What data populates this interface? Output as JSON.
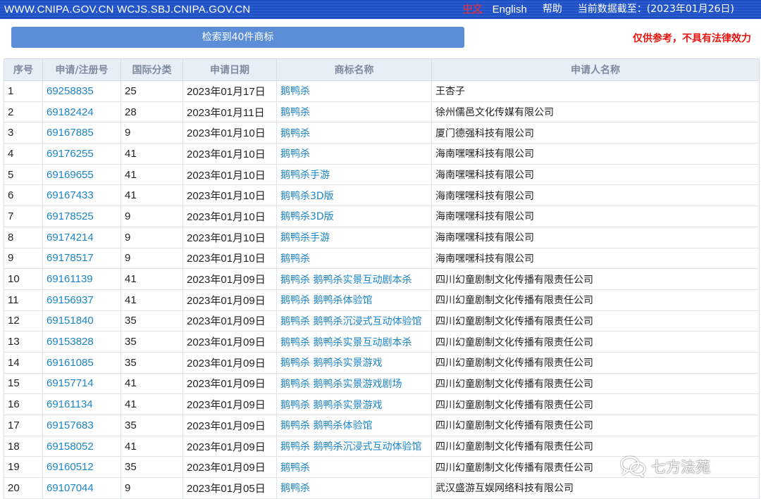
{
  "header": {
    "site": "WWW.CNIPA.GOV.CN WCJS.SBJ.CNIPA.GOV.CN",
    "lang_cn": "中文",
    "lang_en": "English",
    "help": "帮助",
    "data_date": "当前数据截至：(2023年01月26日)"
  },
  "search": {
    "result_label": "检索到40件商标",
    "disclaimer": "仅供参考，不具有法律效力"
  },
  "table": {
    "headers": [
      "序号",
      "申请/注册号",
      "国际分类",
      "申请日期",
      "商标名称",
      "申请人名称"
    ],
    "rows": [
      {
        "no": "1",
        "reg": "69258835",
        "cls": "25",
        "date": "2023年01月17日",
        "mark": "鹅鸭杀",
        "applicant": "王杏子"
      },
      {
        "no": "2",
        "reg": "69182424",
        "cls": "28",
        "date": "2023年01月11日",
        "mark": "鹅鸭杀",
        "applicant": "徐州儒邑文化传媒有限公司"
      },
      {
        "no": "3",
        "reg": "69167885",
        "cls": "9",
        "date": "2023年01月10日",
        "mark": "鹅鸭杀",
        "applicant": "厦门德强科技有限公司"
      },
      {
        "no": "4",
        "reg": "69176255",
        "cls": "41",
        "date": "2023年01月10日",
        "mark": "鹅鸭杀",
        "applicant": "海南嘿嘿科技有限公司"
      },
      {
        "no": "5",
        "reg": "69169655",
        "cls": "41",
        "date": "2023年01月10日",
        "mark": "鹅鸭杀手游",
        "applicant": "海南嘿嘿科技有限公司"
      },
      {
        "no": "6",
        "reg": "69167433",
        "cls": "41",
        "date": "2023年01月10日",
        "mark": "鹅鸭杀3D版",
        "applicant": "海南嘿嘿科技有限公司"
      },
      {
        "no": "7",
        "reg": "69178525",
        "cls": "9",
        "date": "2023年01月10日",
        "mark": "鹅鸭杀3D版",
        "applicant": "海南嘿嘿科技有限公司"
      },
      {
        "no": "8",
        "reg": "69174214",
        "cls": "9",
        "date": "2023年01月10日",
        "mark": "鹅鸭杀手游",
        "applicant": "海南嘿嘿科技有限公司"
      },
      {
        "no": "9",
        "reg": "69178517",
        "cls": "9",
        "date": "2023年01月10日",
        "mark": "鹅鸭杀",
        "applicant": "海南嘿嘿科技有限公司"
      },
      {
        "no": "10",
        "reg": "69161139",
        "cls": "41",
        "date": "2023年01月09日",
        "mark": "鹅鸭杀 鹅鸭杀实景互动剧本杀",
        "applicant": "四川幻童剧制文化传播有限责任公司"
      },
      {
        "no": "11",
        "reg": "69156937",
        "cls": "41",
        "date": "2023年01月09日",
        "mark": "鹅鸭杀 鹅鸭杀体验馆",
        "applicant": "四川幻童剧制文化传播有限责任公司"
      },
      {
        "no": "12",
        "reg": "69151840",
        "cls": "35",
        "date": "2023年01月09日",
        "mark": "鹅鸭杀 鹅鸭杀沉浸式互动体验馆",
        "applicant": "四川幻童剧制文化传播有限责任公司"
      },
      {
        "no": "13",
        "reg": "69153828",
        "cls": "35",
        "date": "2023年01月09日",
        "mark": "鹅鸭杀 鹅鸭杀实景互动剧本杀",
        "applicant": "四川幻童剧制文化传播有限责任公司"
      },
      {
        "no": "14",
        "reg": "69161085",
        "cls": "35",
        "date": "2023年01月09日",
        "mark": "鹅鸭杀 鹅鸭杀实景游戏",
        "applicant": "四川幻童剧制文化传播有限责任公司"
      },
      {
        "no": "15",
        "reg": "69157714",
        "cls": "41",
        "date": "2023年01月09日",
        "mark": "鹅鸭杀 鹅鸭杀实景游戏剧场",
        "applicant": "四川幻童剧制文化传播有限责任公司"
      },
      {
        "no": "16",
        "reg": "69161134",
        "cls": "41",
        "date": "2023年01月09日",
        "mark": "鹅鸭杀 鹅鸭杀实景游戏",
        "applicant": "四川幻童剧制文化传播有限责任公司"
      },
      {
        "no": "17",
        "reg": "69157683",
        "cls": "35",
        "date": "2023年01月09日",
        "mark": "鹅鸭杀 鹅鸭杀体验馆",
        "applicant": "四川幻童剧制文化传播有限责任公司"
      },
      {
        "no": "18",
        "reg": "69158052",
        "cls": "41",
        "date": "2023年01月09日",
        "mark": "鹅鸭杀 鹅鸭杀沉浸式互动体验馆",
        "applicant": "四川幻童剧制文化传播有限责任公司"
      },
      {
        "no": "19",
        "reg": "69160512",
        "cls": "35",
        "date": "2023年01月09日",
        "mark": "鹅鸭杀",
        "applicant": "四川幻童剧制文化传播有限责任公司"
      },
      {
        "no": "20",
        "reg": "69107044",
        "cls": "9",
        "date": "2023年01月05日",
        "mark": "鹅鸭杀",
        "applicant": "武汉盛游互娱网络科技有限公司"
      }
    ]
  },
  "watermark": {
    "text": "七方法苑",
    "icon": "wechat-icon"
  }
}
